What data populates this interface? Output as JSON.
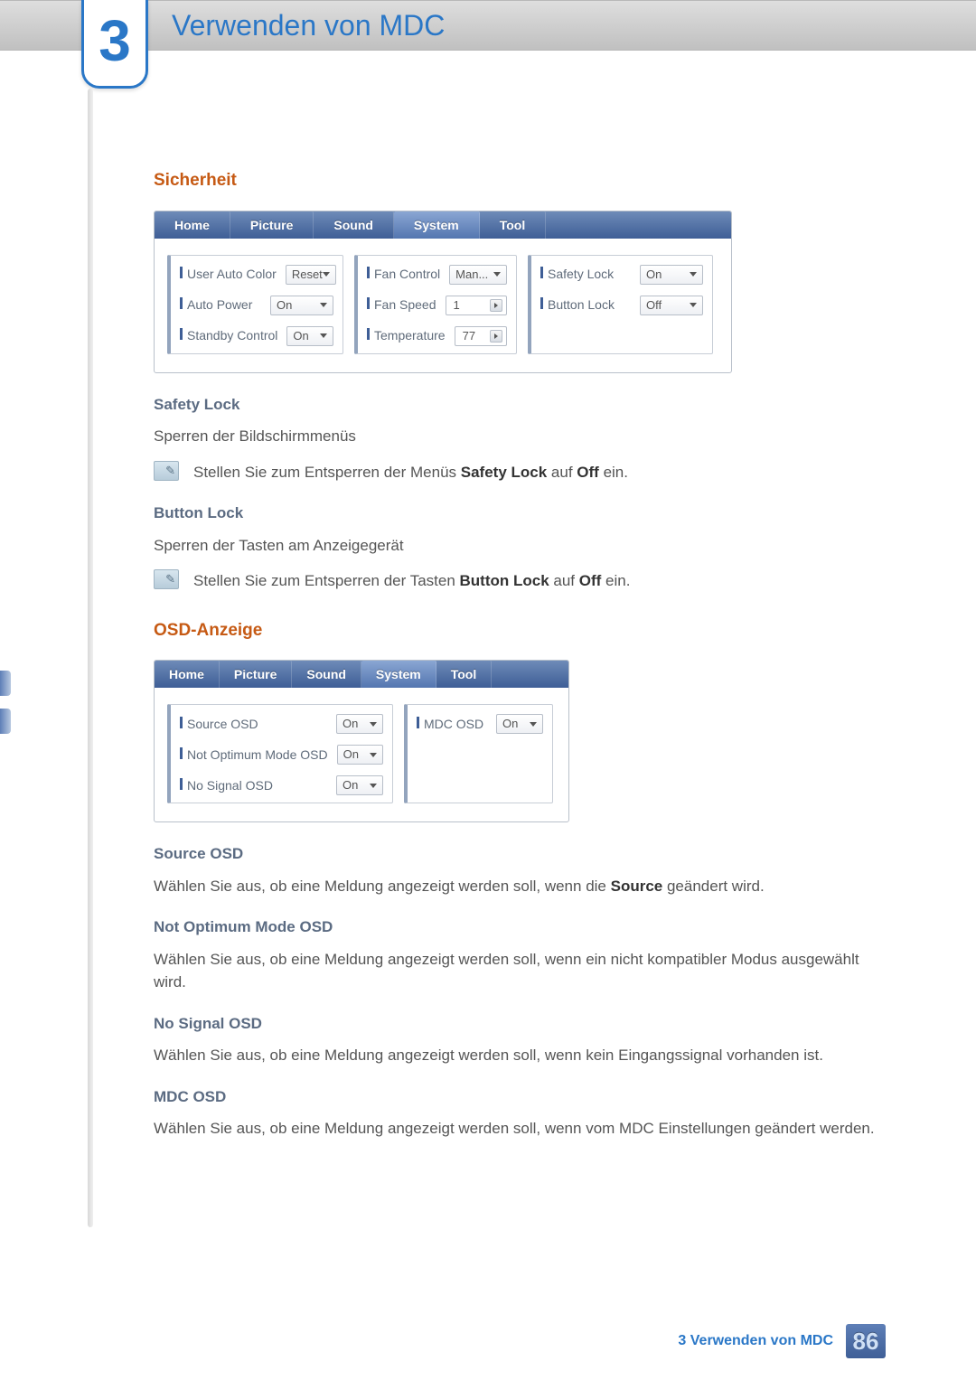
{
  "chapter": {
    "number": "3",
    "title": "Verwenden von MDC"
  },
  "sections": {
    "sicherheit": {
      "heading": "Sicherheit",
      "panel": {
        "tabs": [
          "Home",
          "Picture",
          "Sound",
          "System",
          "Tool"
        ],
        "active_tab_index": 3,
        "group1": {
          "user_auto_color": {
            "label": "User Auto Color",
            "value": "Reset"
          },
          "auto_power": {
            "label": "Auto Power",
            "value": "On"
          },
          "standby_control": {
            "label": "Standby Control",
            "value": "On"
          }
        },
        "group2": {
          "fan_control": {
            "label": "Fan Control",
            "value": "Man..."
          },
          "fan_speed": {
            "label": "Fan Speed",
            "value": "1"
          },
          "temperature": {
            "label": "Temperature",
            "value": "77"
          }
        },
        "group3": {
          "safety_lock": {
            "label": "Safety Lock",
            "value": "On"
          },
          "button_lock": {
            "label": "Button Lock",
            "value": "Off"
          }
        }
      },
      "safety_lock": {
        "heading": "Safety Lock",
        "desc": "Sperren der Bildschirmmenüs",
        "note_pre": "Stellen Sie zum Entsperren der Menüs ",
        "note_bold": "Safety Lock",
        "note_mid": " auf ",
        "note_bold2": "Off",
        "note_post": " ein."
      },
      "button_lock": {
        "heading": "Button Lock",
        "desc": "Sperren der Tasten am Anzeigegerät",
        "note_pre": "Stellen Sie zum Entsperren der Tasten ",
        "note_bold": "Button Lock",
        "note_mid": " auf ",
        "note_bold2": "Off",
        "note_post": " ein."
      }
    },
    "osd": {
      "heading": "OSD-Anzeige",
      "panel": {
        "tabs": [
          "Home",
          "Picture",
          "Sound",
          "System",
          "Tool"
        ],
        "active_tab_index": 3,
        "group1": {
          "source_osd": {
            "label": "Source OSD",
            "value": "On"
          },
          "not_optimum_mode": {
            "label": "Not Optimum Mode OSD",
            "value": "On"
          },
          "no_signal_osd": {
            "label": "No Signal OSD",
            "value": "On"
          }
        },
        "group2": {
          "mdc_osd": {
            "label": "MDC OSD",
            "value": "On"
          }
        }
      },
      "source_osd": {
        "heading": "Source OSD",
        "text_pre": "Wählen Sie aus, ob eine Meldung angezeigt werden soll, wenn die ",
        "text_bold": "Source",
        "text_post": " geändert wird."
      },
      "not_optimum": {
        "heading": "Not Optimum Mode OSD",
        "text": "Wählen Sie aus, ob eine Meldung angezeigt werden soll, wenn ein nicht kompatibler Modus ausgewählt wird."
      },
      "no_signal": {
        "heading": "No Signal OSD",
        "text": "Wählen Sie aus, ob eine Meldung angezeigt werden soll, wenn kein Eingangssignal vorhanden ist."
      },
      "mdc_osd": {
        "heading": "MDC OSD",
        "text": "Wählen Sie aus, ob eine Meldung angezeigt werden soll, wenn vom MDC Einstellungen geändert werden."
      }
    }
  },
  "footer": {
    "label": "3 Verwenden von MDC",
    "page": "86"
  }
}
